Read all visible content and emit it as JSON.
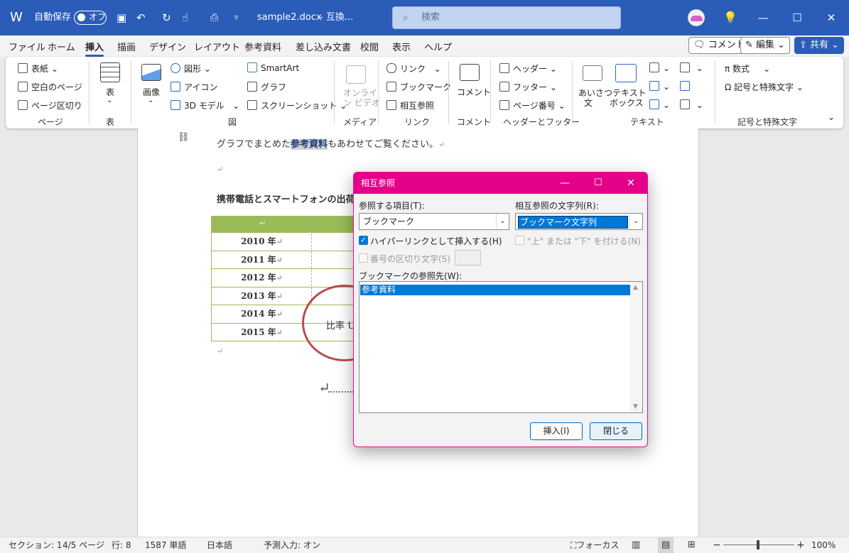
{
  "titlebar": {
    "autosave_label": "自動保存",
    "autosave_toggle": "オフ",
    "doc_title": "sample2.docx",
    "compat_mode": "- 互換...",
    "search_placeholder": "検索",
    "minimize": "—",
    "maximize": "☐",
    "close": "✕"
  },
  "menu": {
    "tabs": [
      "ファイル",
      "ホーム",
      "挿入",
      "描画",
      "デザイン",
      "レイアウト",
      "参考資料",
      "差し込み文書",
      "校閲",
      "表示",
      "ヘルプ"
    ],
    "active_tab": "挿入",
    "comment_button": "コメント",
    "edit_button": "編集",
    "share_button": "共有"
  },
  "ribbon": {
    "pages": {
      "cover": "表紙",
      "blank": "空白のページ",
      "break": "ページ区切り",
      "group": "ページ"
    },
    "table": {
      "label": "表",
      "group": "表"
    },
    "illustrations": {
      "picture": "画像",
      "shapes": "図形",
      "icons": "アイコン",
      "models": "3D モデル",
      "smartart": "SmartArt",
      "chart": "グラフ",
      "screenshot": "スクリーンショット",
      "group": "図"
    },
    "media": {
      "video_line1": "オンライ",
      "video_line2": "ン ビデオ",
      "group": "メディア"
    },
    "links": {
      "link": "リンク",
      "bookmark": "ブックマーク",
      "crossref": "相互参照",
      "group": "リンク"
    },
    "comments": {
      "comment": "コメント",
      "group": "コメント"
    },
    "headerfooter": {
      "header": "ヘッダー",
      "footer": "フッター",
      "pagenum": "ページ番号",
      "group": "ヘッダーとフッター"
    },
    "text": {
      "greeting_line1": "あいさつ",
      "greeting_line2": "文",
      "textbox_line1": "テキスト",
      "textbox_line2": "ボックス",
      "group": "テキスト"
    },
    "symbols": {
      "equation": "数式",
      "symbol": "記号と特殊文字",
      "group": "記号と特殊文字"
    }
  },
  "document": {
    "line1_before": "グラフでまとめた",
    "line1_highlight": "参考資料",
    "line1_after": "もあわせてご覧ください。",
    "heading": "携帯電話とスマートフォンの出荷",
    "years": [
      "2010 年",
      "2011 年",
      "2012 年",
      "2013 年",
      "2014 年",
      "2015 年"
    ],
    "circle_text": "比率 U",
    "para_mark": "↵"
  },
  "dialog": {
    "title": "相互参照",
    "ref_type_label": "参照する項目(T):",
    "ref_type_value": "ブックマーク",
    "insert_ref_label": "相互参照の文字列(R):",
    "insert_ref_value": "ブックマーク文字列",
    "hyperlink_label": "ハイパーリンクとして挿入する(H)",
    "above_below_label": "\"上\" または \"下\" を付ける(N)",
    "separator_label": "番号の区切り文字(S)",
    "for_which_label": "ブックマークの参照先(W):",
    "items": [
      "参考資料"
    ],
    "insert_button": "挿入(I)",
    "close_button": "閉じる"
  },
  "status": {
    "section": "セクション: 1",
    "page": "4/5 ページ",
    "line": "行: 8",
    "words": "1587 単語",
    "language": "日本語",
    "predict": "予測入力: オン",
    "focus": "フォーカス",
    "zoom": "100%",
    "zoom_minus": "−",
    "zoom_plus": "+"
  },
  "colors": {
    "titlebar": "#2b5cb8",
    "dialog_title": "#e5008a",
    "table_header": "#9bbb59",
    "circle": "#b94d4d",
    "selection": "#0078d7"
  }
}
